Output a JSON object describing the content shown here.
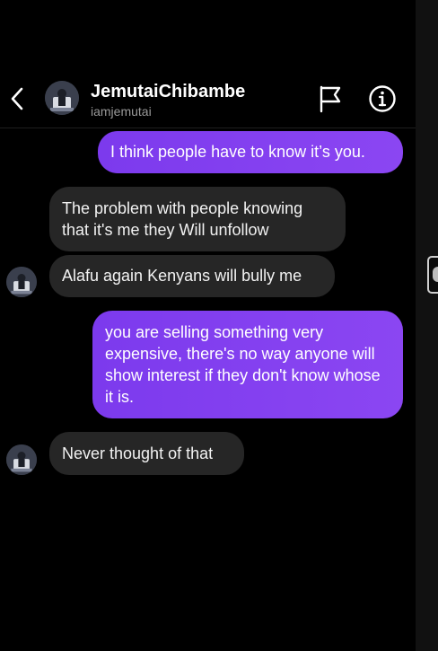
{
  "contact": {
    "name": "JemutaiChibambe",
    "handle": "iamjemutai"
  },
  "messages": [
    {
      "from": "me",
      "text": "I think people have to know it’s you."
    },
    {
      "from": "them",
      "text": "The problem with people knowing that it's me they Will unfollow"
    },
    {
      "from": "them",
      "text": "Alafu again Kenyans will bully me"
    },
    {
      "from": "me",
      "text": "you are selling something very expensive, there's no way anyone will show interest if they don't know whose it is."
    },
    {
      "from": "them",
      "text": "Never thought of that"
    }
  ],
  "colors": {
    "outgoing_bubble": "#7c3aed",
    "incoming_bubble": "#262626",
    "background": "#000000"
  },
  "icons": [
    "back-arrow-icon",
    "flag-icon",
    "info-icon"
  ]
}
